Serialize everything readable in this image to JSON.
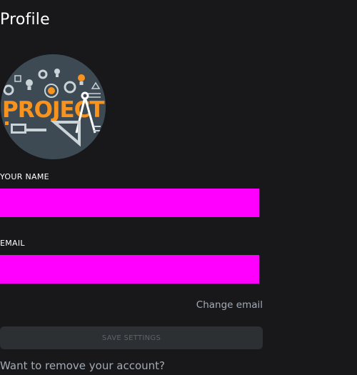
{
  "page": {
    "title": "Profile"
  },
  "avatar": {
    "image_text": "PROJECT"
  },
  "form": {
    "name_label": "YOUR NAME",
    "name_value": "",
    "email_label": "EMAIL",
    "email_value": "",
    "change_email_label": "Change email",
    "save_label": "SAVE SETTINGS",
    "remove_account_label": "Want to remove your account?"
  },
  "colors": {
    "background": "#18181b",
    "input_fill": "#ff00ff",
    "button_bg": "#2c3033",
    "muted_text": "#a3abb5",
    "accent_orange": "#f7931e"
  }
}
